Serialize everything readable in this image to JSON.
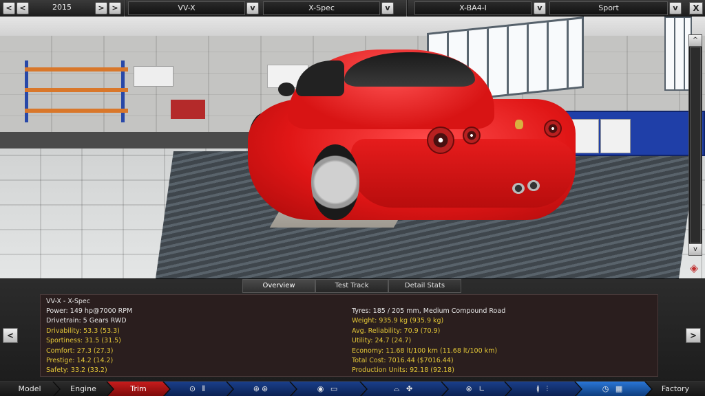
{
  "topbar": {
    "year": "2015",
    "model": "VV-X",
    "trim": "X-Spec",
    "engine": "X-BA4-I",
    "variant": "Sport"
  },
  "tabs": [
    {
      "label": "Overview"
    },
    {
      "label": "Test Track"
    },
    {
      "label": "Detail Stats"
    }
  ],
  "stats": {
    "title": "VV-X - X-Spec",
    "left": [
      {
        "label": "Power:",
        "value": "149 hp@7000 RPM",
        "highlight": false
      },
      {
        "label": "Drivetrain:",
        "value": "5 Gears RWD",
        "highlight": false
      },
      {
        "label": "Drivability:",
        "value": "53.3 (53.3)",
        "highlight": true
      },
      {
        "label": "Sportiness:",
        "value": "31.5 (31.5)",
        "highlight": true
      },
      {
        "label": "Comfort:",
        "value": "27.3 (27.3)",
        "highlight": true
      },
      {
        "label": "Prestige:",
        "value": "14.2 (14.2)",
        "highlight": true
      },
      {
        "label": "Safety:",
        "value": "33.2 (33.2)",
        "highlight": true
      }
    ],
    "right": [
      {
        "label": "Tyres:",
        "value": "185 / 205 mm, Medium Compound Road",
        "highlight": false
      },
      {
        "label": "Weight:",
        "value": "935.9 kg (935.9 kg)",
        "highlight": true
      },
      {
        "label": "Avg. Reliability:",
        "value": "70.9 (70.9)",
        "highlight": true
      },
      {
        "label": "Utility:",
        "value": "24.7 (24.7)",
        "highlight": true
      },
      {
        "label": "Economy:",
        "value": "11.68 lt/100 km (11.68 lt/100 km)",
        "highlight": true
      },
      {
        "label": "Total Cost:",
        "value": "7016.44 ($7016.44)",
        "highlight": true
      },
      {
        "label": "Production Units:",
        "value": "92.18 (92.18)",
        "highlight": true
      }
    ]
  },
  "nav": {
    "model": "Model",
    "engine": "Engine",
    "trim": "Trim",
    "factory": "Factory"
  },
  "buttons": {
    "left": "<",
    "right": ">",
    "dropdown": "v",
    "close": "X",
    "up": "^"
  },
  "colors": {
    "highlight": "#e4c838",
    "active_tab": "#c81c1c",
    "accent_blue": "#2a76d6"
  }
}
